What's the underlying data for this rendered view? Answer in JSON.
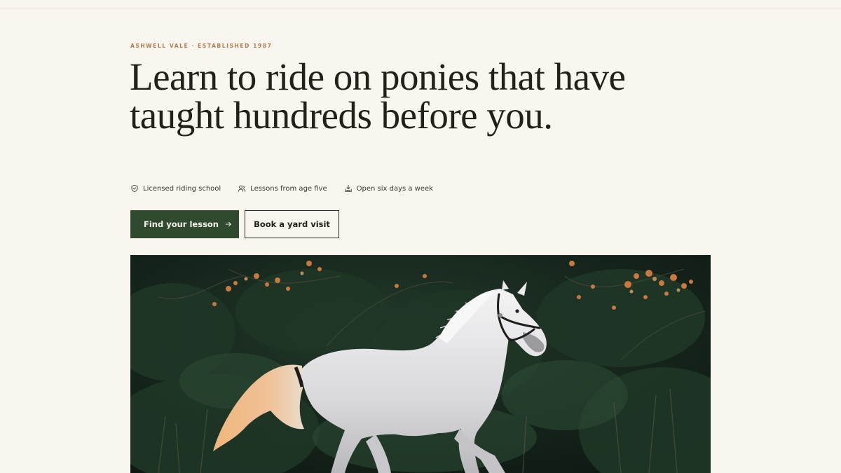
{
  "hero": {
    "eyebrow": "ASHWELL VALE · ESTABLISHED 1987",
    "headline": "Learn to ride on ponies that have taught hundreds before you.",
    "features": [
      {
        "icon": "shield-check-icon",
        "label": "Licensed riding school"
      },
      {
        "icon": "users-icon",
        "label": "Lessons from age five"
      },
      {
        "icon": "calendar-icon",
        "label": "Open six days a week"
      }
    ],
    "primary_button": {
      "label": "Find your lesson",
      "icon": "arrow-right-icon"
    },
    "secondary_button": {
      "label": "Book a yard visit"
    },
    "image": {
      "subject": "white horse cantering in front of dark foliage"
    }
  },
  "colors": {
    "background": "#f9f6f0",
    "accent_green": "#2f4a2e",
    "eyebrow_brown": "#b07a4c",
    "text_dark": "#23201b"
  }
}
